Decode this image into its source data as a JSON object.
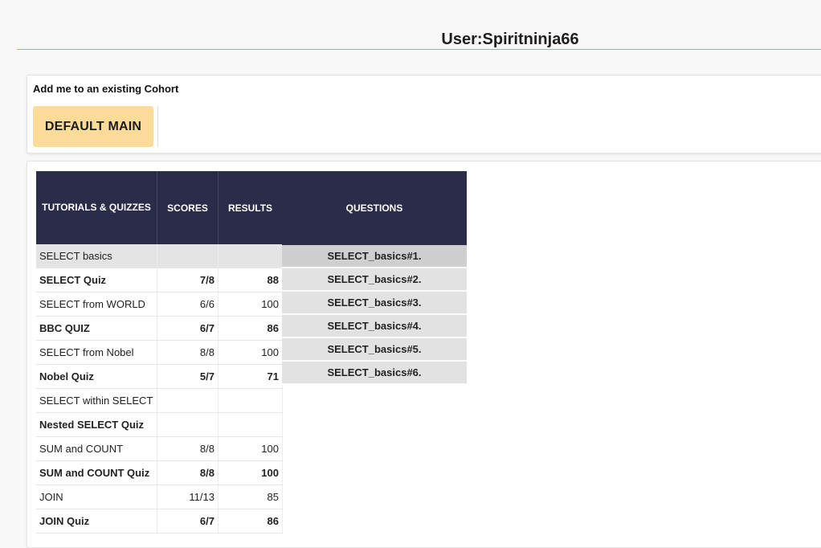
{
  "page": {
    "title": "User:Spiritninja66"
  },
  "cohort": {
    "label": "Add me to an existing Cohort",
    "button_label": "DEFAULT MAIN"
  },
  "score_table": {
    "headers": [
      "TUTORIALS & QUIZZES",
      "SCORES",
      "RESULTS"
    ],
    "rows": [
      {
        "name": "SELECT basics",
        "score": "",
        "result": ""
      },
      {
        "name": "SELECT Quiz",
        "score": "7/8",
        "result": "88"
      },
      {
        "name": "SELECT from WORLD",
        "score": "6/6",
        "result": "100"
      },
      {
        "name": "BBC QUIZ",
        "score": "6/7",
        "result": "86"
      },
      {
        "name": "SELECT from Nobel",
        "score": "8/8",
        "result": "100"
      },
      {
        "name": "Nobel Quiz",
        "score": "5/7",
        "result": "71"
      },
      {
        "name": "SELECT within SELECT",
        "score": "",
        "result": ""
      },
      {
        "name": "Nested SELECT Quiz",
        "score": "",
        "result": ""
      },
      {
        "name": "SUM and COUNT",
        "score": "8/8",
        "result": "100"
      },
      {
        "name": "SUM and COUNT Quiz",
        "score": "8/8",
        "result": "100"
      },
      {
        "name": "JOIN",
        "score": "11/13",
        "result": "85"
      },
      {
        "name": "JOIN Quiz",
        "score": "6/7",
        "result": "86"
      }
    ]
  },
  "questions_table": {
    "header": "QUESTIONS",
    "items": [
      "SELECT_basics#1.",
      "SELECT_basics#2.",
      "SELECT_basics#3.",
      "SELECT_basics#4.",
      "SELECT_basics#5.",
      "SELECT_basics#6."
    ]
  },
  "colors": {
    "header_bg": "#2b2b4a",
    "button_bg": "#fddb99",
    "rule": "#e0a060",
    "highlight_row": "#e4e4e4"
  }
}
